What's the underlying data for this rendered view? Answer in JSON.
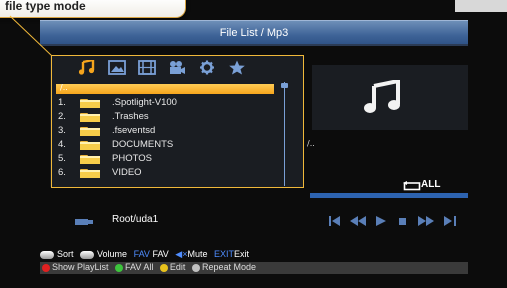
{
  "callout": {
    "text": "file type mode"
  },
  "header": {
    "title": "File List / Mp3"
  },
  "tabs": [
    {
      "icon": "music-note-icon"
    },
    {
      "icon": "image-icon"
    },
    {
      "icon": "film-icon"
    },
    {
      "icon": "video-camera-icon"
    },
    {
      "icon": "gear-icon"
    },
    {
      "icon": "star-icon"
    }
  ],
  "selected_path": "/..",
  "files": [
    {
      "num": "1.",
      "name": ".Spotlight-V100"
    },
    {
      "num": "2.",
      "name": ".Trashes"
    },
    {
      "num": "3.",
      "name": ".fseventsd"
    },
    {
      "num": "4.",
      "name": "DOCUMENTS"
    },
    {
      "num": "5.",
      "name": "PHOTOS"
    },
    {
      "num": "6.",
      "name": "VIDEO"
    }
  ],
  "preview": {
    "path": "/..",
    "repeat_label": "ALL",
    "progress": 0
  },
  "device": {
    "path": "Root/uda1"
  },
  "transport": [
    "skip-back-icon",
    "rewind-icon",
    "play-icon",
    "stop-icon",
    "fast-forward-icon",
    "skip-forward-icon"
  ],
  "legend1": {
    "sort": "Sort",
    "volume": "Volume",
    "fav_key": "FAV",
    "fav": "FAV",
    "mute": "Mute",
    "exit_key": "EXIT",
    "exit": "Exit"
  },
  "legend2": {
    "red": "Show PlayList",
    "green": "FAV All",
    "yellow": "Edit",
    "blue": "Repeat Mode"
  },
  "colors": {
    "accent_orange": "#f6a51d",
    "header_blue": "#3e6397",
    "outline_yellow": "#f0b83a",
    "red_key": "#e02020",
    "green_key": "#3cc43c",
    "yellow_key": "#e8c21c",
    "blue_key": "#c0c0c0"
  }
}
